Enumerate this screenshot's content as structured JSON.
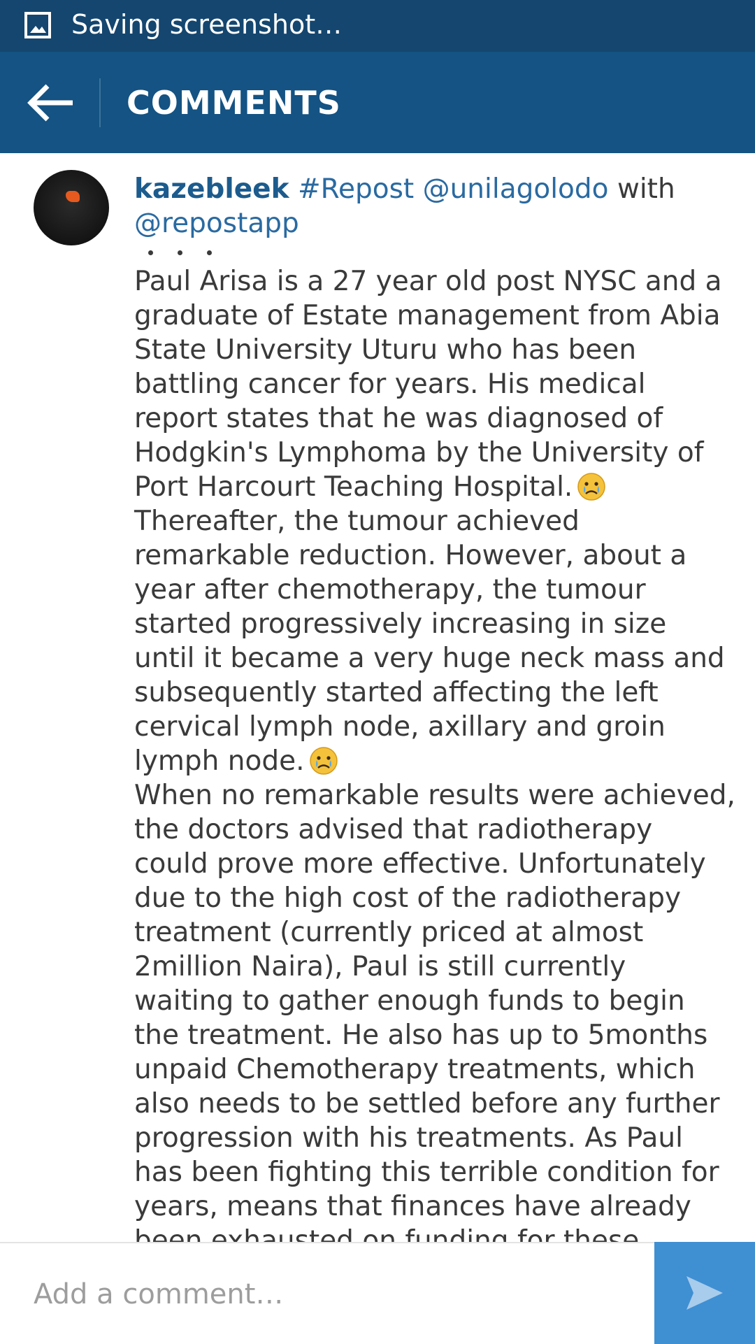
{
  "status_bar": {
    "text": "Saving screenshot…",
    "icon": "image-icon"
  },
  "header": {
    "title": "COMMENTS",
    "back_icon": "back-arrow-icon"
  },
  "comment": {
    "username": "kazebleek",
    "hashtag": "#Repost",
    "mention": "@unilagolodo",
    "with_text": "with",
    "app_mention": "@repostapp",
    "lines": [
      "Paul Arisa is a 27 year old post NYSC and a",
      "graduate of Estate management from Abia",
      "State University Uturu who has been",
      "battling cancer for years. His medical",
      "report states that he was diagnosed of",
      "Hodgkin's Lymphoma by the University of",
      "Port Harcourt Teaching Hospital.",
      "Thereafter, the tumour achieved",
      "remarkable reduction. However, about a",
      "year after chemotherapy, the tumour",
      "started progressively increasing in size",
      "until it became a very huge neck mass and",
      "subsequently started affecting the left",
      "cervical lymph node, axillary and groin",
      "lymph node.",
      "When no remarkable results were achieved,",
      "the doctors advised that radiotherapy",
      "could prove more effective. Unfortunately",
      "due to the high cost of the radiotherapy",
      "treatment (currently priced at almost",
      "2million Naira), Paul is still currently",
      "waiting to gather enough funds to begin",
      "the treatment. He also has up to 5months",
      "unpaid Chemotherapy treatments, which",
      "also needs to be settled before any further",
      "progression with his treatments. As Paul",
      "has been fighting this terrible condition for",
      "years, means that finances have already",
      "been exhausted on funding for these"
    ],
    "emoji": "crying-face-emoji"
  },
  "comment_bar": {
    "placeholder": "Add a comment…",
    "send_icon": "send-icon"
  },
  "colors": {
    "status_bar": "#14466f",
    "header": "#145383",
    "username": "#1c5b8d",
    "link": "#2a6aa1",
    "send_button": "#3f8fd3"
  }
}
